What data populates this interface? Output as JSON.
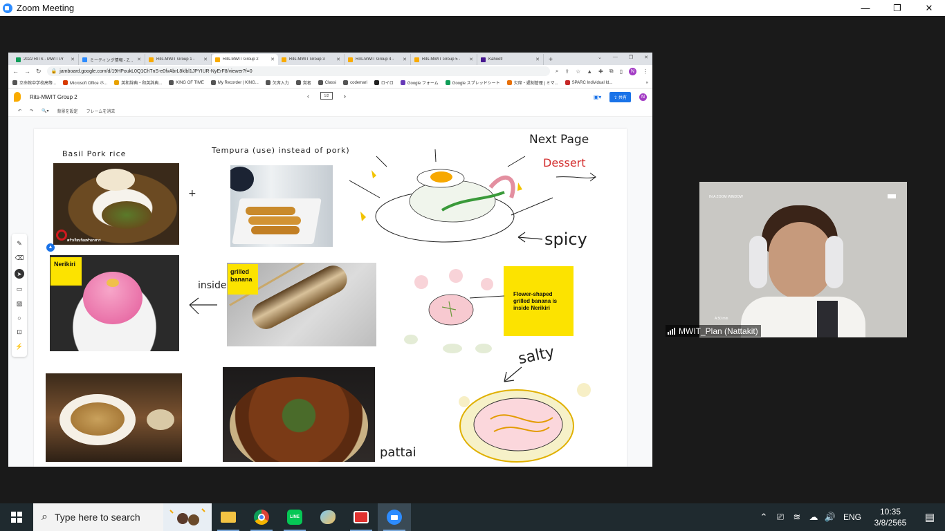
{
  "zoom": {
    "window_title": "Zoom Meeting",
    "minimize": "—",
    "restore": "❐",
    "close": "✕",
    "participant_name": "MWIT_Plan (Nattakit)",
    "camera_overlay": "IN A ZOOM WINDOW",
    "camera_overlay_bottom": "A 50 min"
  },
  "browser": {
    "tabs": [
      {
        "label": "2022 RITS - MWIT Pr",
        "color": "#0f9d58"
      },
      {
        "label": "ミーティング情報 - Zoom",
        "color": "#2d8cff"
      },
      {
        "label": "Rits-MWIT Group 1 -",
        "color": "#f9ab00"
      },
      {
        "label": "Rits-MWIT Group 2",
        "color": "#f9ab00"
      },
      {
        "label": "Rits-MWIT Group 3",
        "color": "#f9ab00"
      },
      {
        "label": "Rits-MWIT Group 4 -",
        "color": "#f9ab00"
      },
      {
        "label": "Rits-MWIT Group 5 -",
        "color": "#f9ab00"
      },
      {
        "label": "Kahoot!",
        "color": "#46178f"
      }
    ],
    "active_tab": 3,
    "new_tab": "+",
    "url": "jamboard.google.com/d/19HPoukL0Q1ChTnS-e0fvAbrL8klbl1JPYIUR-NyErF8/viewer?f=0",
    "profile_initial": "N",
    "bookmarks": [
      {
        "label": "立命館中学校高等...",
        "color": "#555"
      },
      {
        "label": "Microsoft Office ホ...",
        "color": "#d83b01"
      },
      {
        "label": "英和辞典・和英辞典...",
        "color": "#e8a200"
      },
      {
        "label": "KING OF TIME",
        "color": "#555"
      },
      {
        "label": "My Recorder | KING...",
        "color": "#555"
      },
      {
        "label": "欠席入力",
        "color": "#555"
      },
      {
        "label": "賞者",
        "color": "#555"
      },
      {
        "label": "Classi",
        "color": "#555"
      },
      {
        "label": "codemari",
        "color": "#555"
      },
      {
        "label": "ロイロ",
        "color": "#222"
      },
      {
        "label": "Google フォーム",
        "color": "#673ab7"
      },
      {
        "label": "Google スプレッドシート",
        "color": "#0f9d58"
      },
      {
        "label": "欠席・遅刻管理 | ミマ...",
        "color": "#e8710a"
      },
      {
        "label": "SPARC Individual Id...",
        "color": "#c62828"
      }
    ]
  },
  "jamboard": {
    "title": "Rits-MWIT Group 2",
    "page": "1/2",
    "share_label": "共有",
    "toolbar": {
      "bg_label": "背景を設定",
      "clear_label": "フレームを消去"
    },
    "notes": {
      "nerikiri": "Nerikiri",
      "grilled_banana": "grilled banana",
      "flower": "Flower-shaped grilled banana is inside Nerikiri"
    },
    "handwriting": {
      "basil": "Basil Pork rice",
      "tempura": "Tempura (use) instead of pork)",
      "next_page": "Next Page",
      "dessert": "Dessert",
      "spicy": "spicy",
      "inside": "inside",
      "salty": "salty",
      "plus": "+"
    },
    "typed_text": "pattai",
    "photo_watermark": "ครัวเรียบร้อยทำอาหาร"
  },
  "taskbar": {
    "search_placeholder": "Type here to search",
    "language": "ENG",
    "time": "10:35",
    "date": "3/8/2565"
  }
}
